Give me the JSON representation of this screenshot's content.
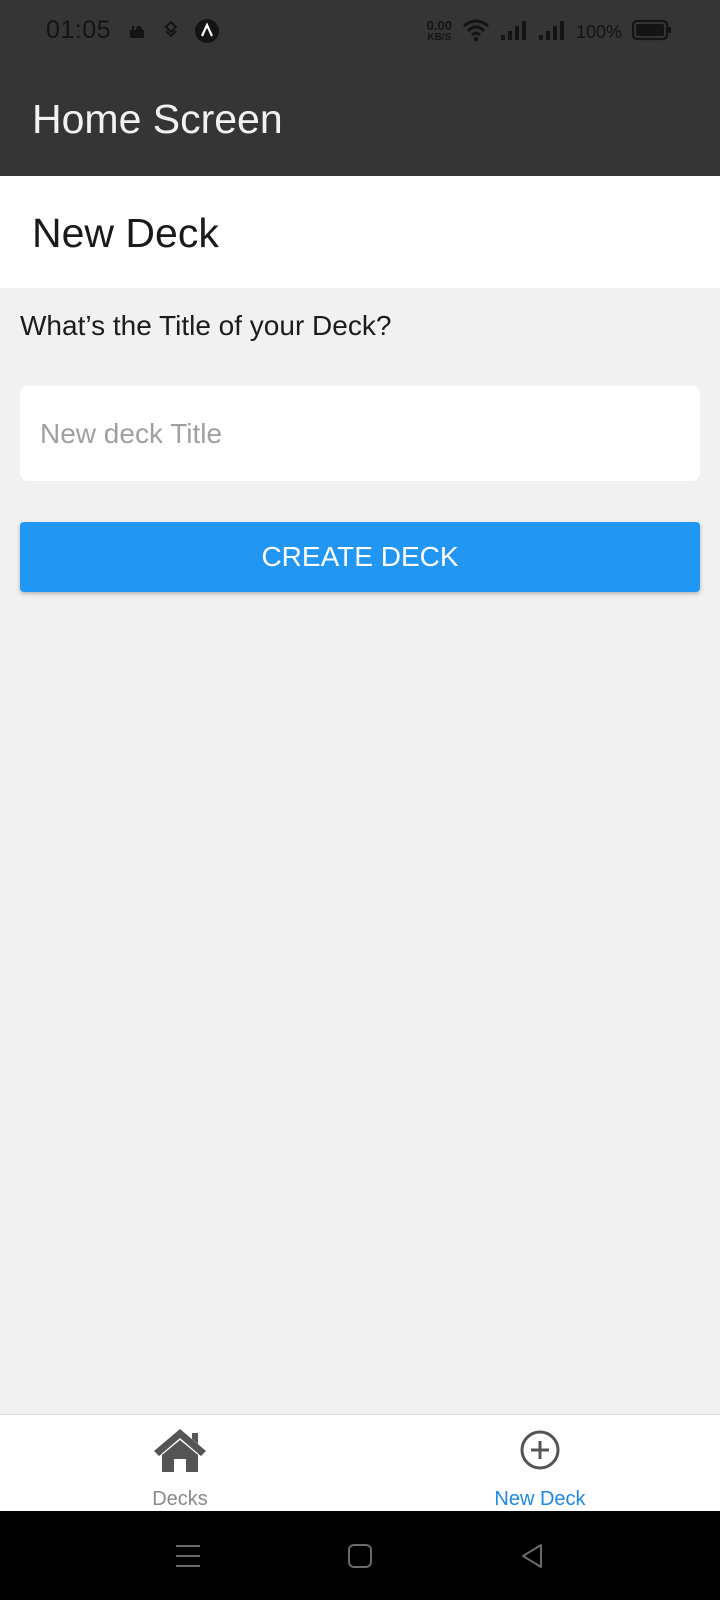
{
  "status_bar": {
    "time": "01:05",
    "net_speed_value": "0.00",
    "net_speed_unit": "KB/S",
    "battery": "100%",
    "icons": [
      "mosque-icon",
      "vpn-icon",
      "app-a-icon",
      "wifi-icon",
      "signal-icon",
      "signal-icon",
      "battery-icon"
    ]
  },
  "app_bar": {
    "title": "Home Screen"
  },
  "screen": {
    "title": "New Deck",
    "prompt": "What’s the Title of your Deck?",
    "input_placeholder": "New deck Title",
    "input_value": "",
    "create_button": "CREATE DECK"
  },
  "tabs": [
    {
      "label": "Decks",
      "icon": "home-icon",
      "active": false
    },
    {
      "label": "New Deck",
      "icon": "plus-circle-icon",
      "active": true
    }
  ],
  "colors": {
    "app_bar": "#353535",
    "primary": "#2196f3",
    "active_tab": "#1e88e5",
    "background": "#f1f1f1"
  }
}
